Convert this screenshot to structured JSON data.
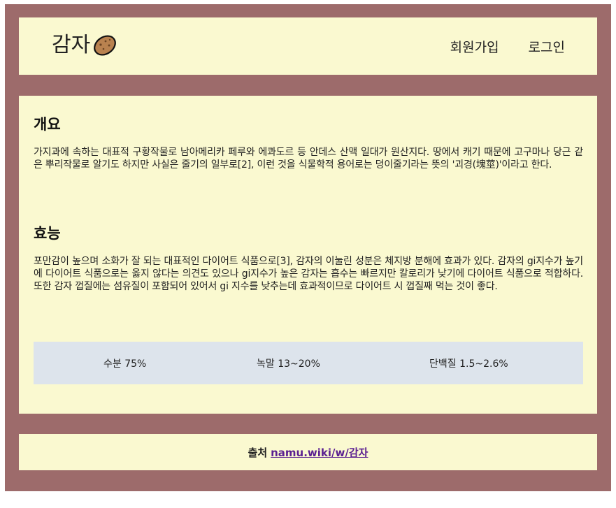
{
  "header": {
    "logo_text": "감자",
    "logo_icon": "potato-icon",
    "nav": {
      "signup": "회원가입",
      "login": "로그인"
    }
  },
  "sections": [
    {
      "title": "개요",
      "body": "가지과에 속하는 대표적 구황작물로 남아메리카 페루와 에콰도르 등 안데스 산맥 일대가 원산지다. 땅에서 캐기 때문에 고구마나 당근 같은 뿌리작물로 알기도 하지만 사실은 줄기의 일부로[2], 이런 것을 식물학적 용어로는 덩이줄기라는 뜻의 '괴경(塊莖)'이라고 한다."
    },
    {
      "title": "효능",
      "body": "포만감이 높으며 소화가 잘 되는 대표적인 다이어트 식품으로[3], 감자의 이눌린 성분은 체지방 분해에 효과가 있다. 감자의 gi지수가 높기에 다이어트 식품으로는 옳지 않다는 의견도 있으나 gi지수가 높은 감자는 흡수는 빠르지만 칼로리가 낮기에 다이어트 식품으로 적합하다. 또한 감자 껍질에는 섬유질이 포함되어 있어서 gi 지수를 낮추는데 효과적이므로 다이어트 시 껍질째 먹는 것이 좋다."
    }
  ],
  "stats": [
    "수분 75%",
    "녹말 13~20%",
    "단백질 1.5~2.6%"
  ],
  "footer": {
    "label": "출처",
    "link_text": "namu.wiki/w/감자"
  },
  "colors": {
    "frame": "#9d6b6b",
    "panel": "#faf9d0",
    "stats_bg": "#dde4ec",
    "link": "#5b1f91"
  }
}
